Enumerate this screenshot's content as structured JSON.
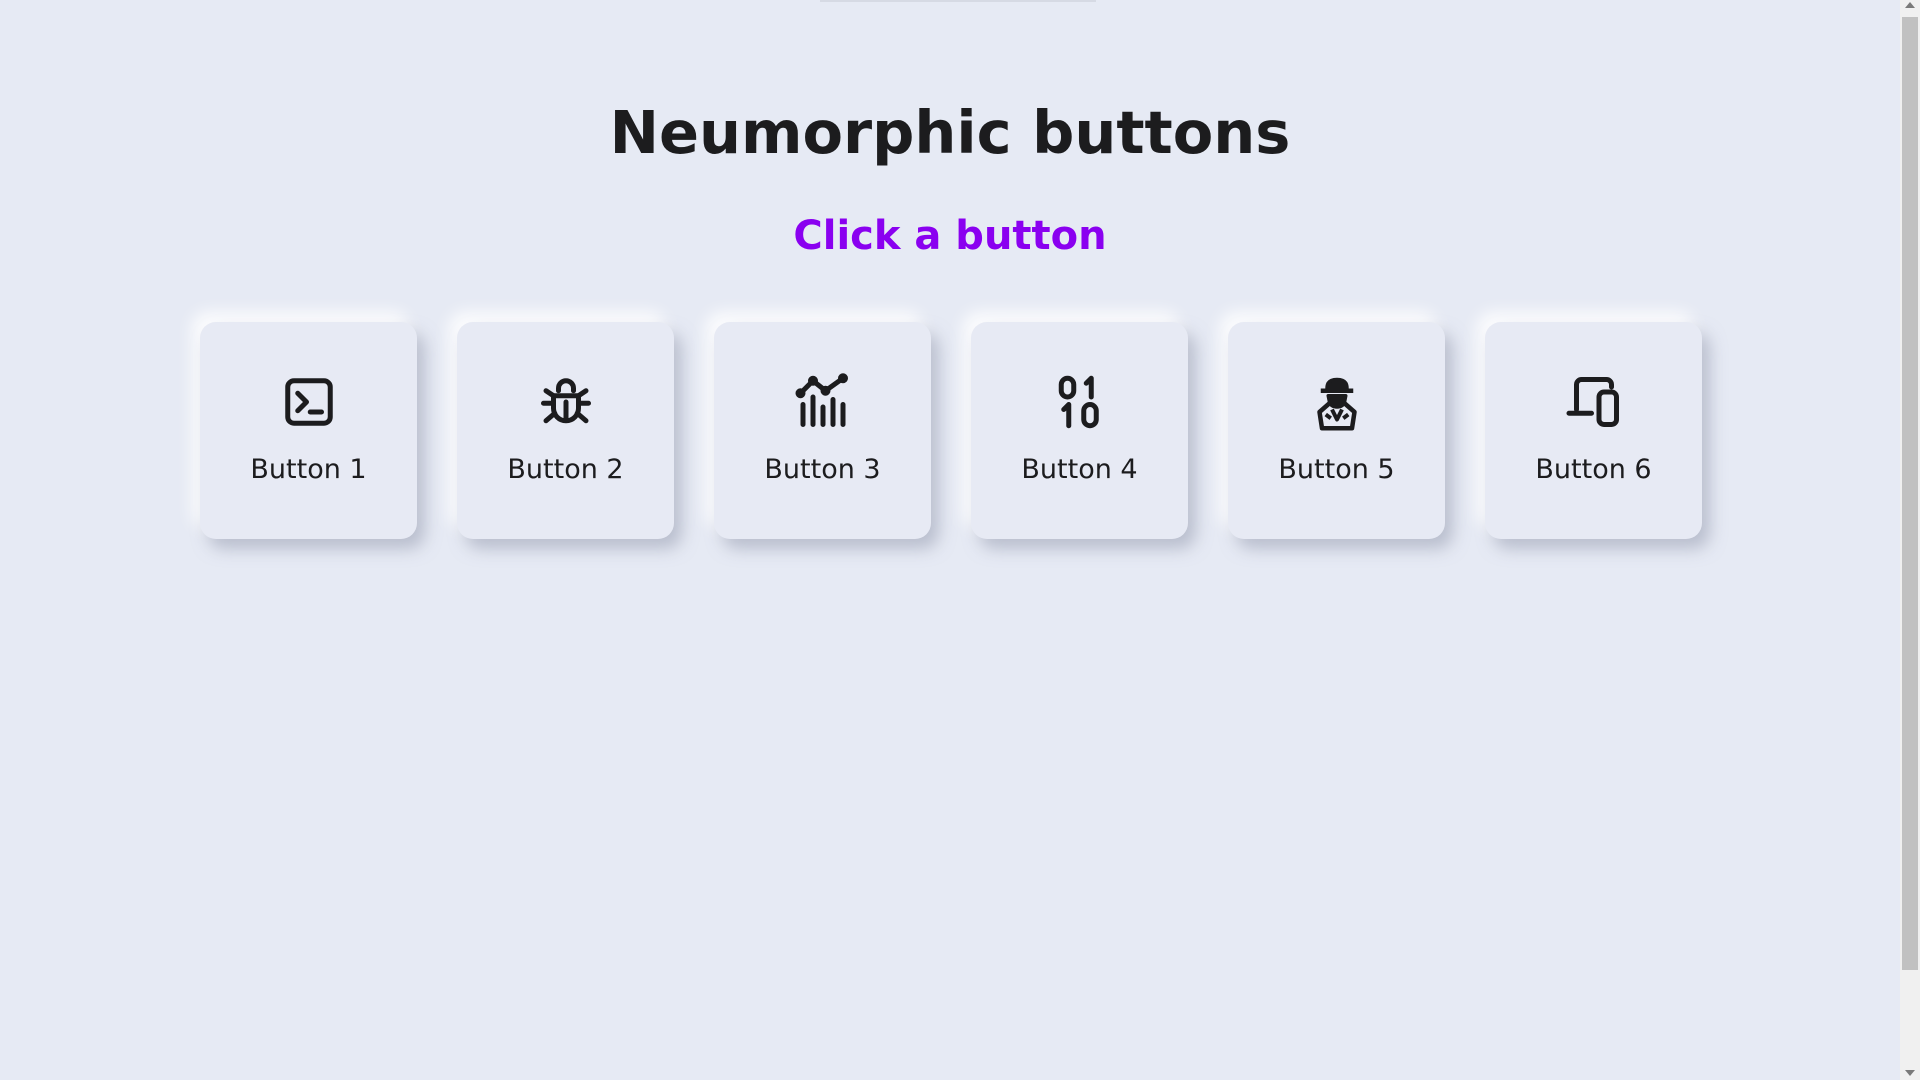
{
  "page": {
    "title": "Neumorphic buttons",
    "subtitle": "Click a button",
    "accent_color": "#8a00f0",
    "background_color": "#e6eaf4"
  },
  "buttons": [
    {
      "label": "Button 1",
      "icon": "terminal-icon"
    },
    {
      "label": "Button 2",
      "icon": "bug-icon"
    },
    {
      "label": "Button 3",
      "icon": "chart-line-icon"
    },
    {
      "label": "Button 4",
      "icon": "binary-icon"
    },
    {
      "label": "Button 5",
      "icon": "spy-icon"
    },
    {
      "label": "Button 6",
      "icon": "devices-icon"
    }
  ]
}
